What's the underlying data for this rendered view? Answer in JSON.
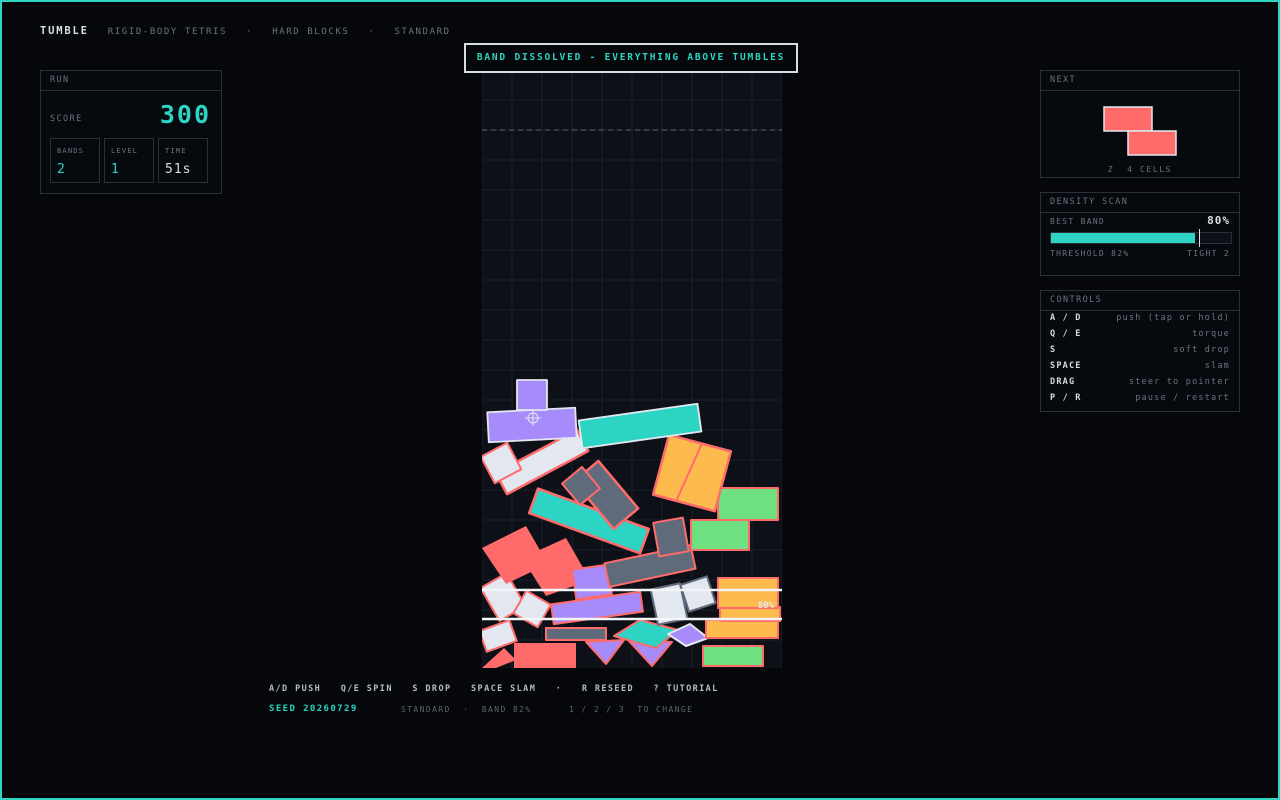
{
  "header": {
    "app_title": "TUMBLE",
    "subtitle": "RIGID-BODY TETRIS",
    "difficulty": "HARD BLOCKS",
    "mode": "STANDARD",
    "separator": "·"
  },
  "run_panel": {
    "title": "RUN",
    "score_label": "SCORE",
    "score": "300",
    "bands_label": "BANDS",
    "bands": "2",
    "level_label": "LEVEL",
    "level": "1",
    "time_label": "TIME",
    "time": "51s"
  },
  "banner": {
    "text": "BAND DISSOLVED  -  EVERYTHING ABOVE TUMBLES"
  },
  "playfield": {
    "band_density_label": "80%"
  },
  "next_panel": {
    "title": "NEXT",
    "piece_name": "Z",
    "piece_cells": "4 CELLS",
    "piece_color": "#ff6b6b"
  },
  "density_panel": {
    "title": "DENSITY SCAN",
    "best_band_label": "BEST BAND",
    "best_band_pct": "80%",
    "best_band_value": 80,
    "threshold_value": 82,
    "threshold_label": "THRESHOLD 82%",
    "tight_label": "TIGHT 2"
  },
  "controls_panel": {
    "title": "CONTROLS",
    "rows": [
      {
        "key": "A / D",
        "action": "push  (tap or hold)"
      },
      {
        "key": "Q / E",
        "action": "torque"
      },
      {
        "key": "S",
        "action": "soft drop"
      },
      {
        "key": "SPACE",
        "action": "slam"
      },
      {
        "key": "DRAG",
        "action": "steer to pointer"
      },
      {
        "key": "P / R",
        "action": "pause / restart"
      }
    ]
  },
  "footer": {
    "help_line": "A/D PUSH   Q/E SPIN   S DROP   SPACE SLAM   ·   R RESEED   ? TUTORIAL",
    "seed": "SEED 20260729",
    "mode_info": "STANDARD  ·  BAND 82%",
    "change_hint": "1 / 2 / 3  TO CHANGE"
  },
  "colors": {
    "accent": "#2dd4c4",
    "coral": "#ff6b6b",
    "violet": "#a78bfa",
    "orange": "#fdba4d",
    "green": "#6ee07f",
    "slate": "#5f6b7a",
    "pale": "#e3e8f0"
  }
}
